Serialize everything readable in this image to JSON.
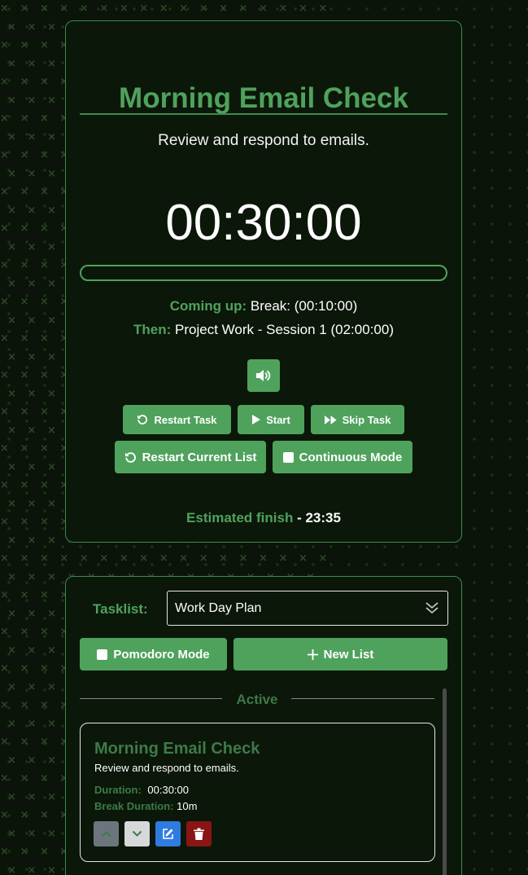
{
  "timer": {
    "title": "Morning Email Check",
    "description": "Review and respond to emails.",
    "time": "00:30:00",
    "progress": 0,
    "coming_up_label": "Coming up:",
    "coming_up_value": "Break: (00:10:00)",
    "then_label": "Then:",
    "then_value": "Project Work - Session 1 (02:00:00)",
    "buttons": {
      "sound_icon": "speaker-icon",
      "restart_task": "Restart Task",
      "start": "Start",
      "skip_task": "Skip Task",
      "restart_list": "Restart Current List",
      "continuous_mode": "Continuous Mode"
    },
    "finish_label": "Estimated finish",
    "finish_sep": " - ",
    "finish_time": "23:35"
  },
  "tasklist": {
    "label": "Tasklist:",
    "selected": "Work Day Plan",
    "pomodoro_mode": "Pomodoro Mode",
    "new_list": "New List",
    "section": "Active",
    "tasks": [
      {
        "title": "Morning Email Check",
        "description": "Review and respond to emails.",
        "duration_label": "Duration:",
        "duration": "00:30:00",
        "break_label": "Break Duration:",
        "break": "10m"
      }
    ]
  },
  "colors": {
    "accent": "#4fa25c",
    "background": "#0a1408",
    "edit": "#2f7be0",
    "delete": "#8a1515",
    "move_up": "#6c757d",
    "move_down": "#d6d8da"
  }
}
